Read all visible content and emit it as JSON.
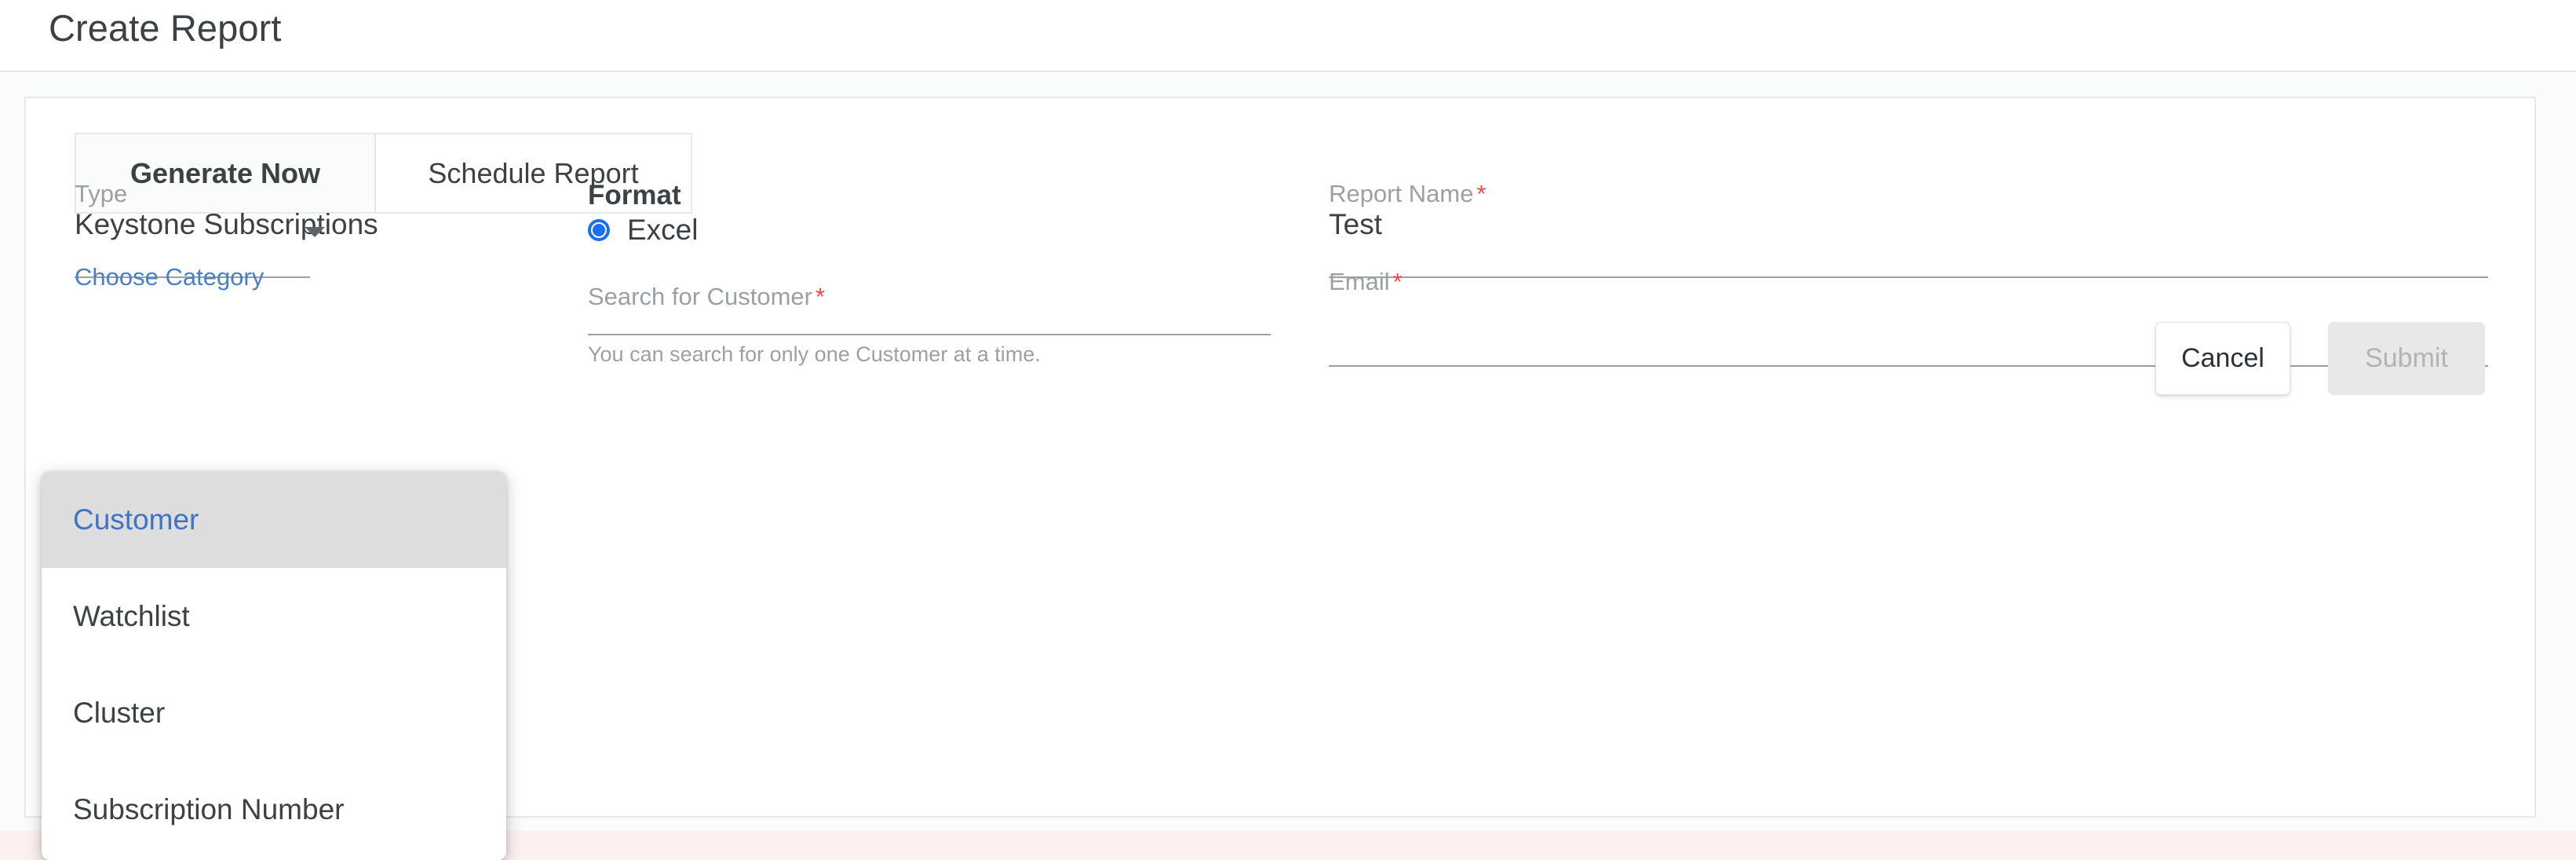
{
  "header": {
    "title": "Create Report"
  },
  "tabs": [
    {
      "label": "Generate Now",
      "active": true
    },
    {
      "label": "Schedule Report",
      "active": false
    }
  ],
  "form": {
    "type": {
      "label": "Type",
      "value": "Keystone Subscriptions",
      "caret_icon": "chevron-down-icon"
    },
    "choose_category": {
      "label": "Choose Category",
      "color": "#4a7fc1"
    },
    "format": {
      "label": "Format",
      "selected": "Excel",
      "options": [
        "Excel"
      ]
    },
    "search_customer": {
      "label": "Search for Customer",
      "required_mark": "*",
      "value": "",
      "placeholder": "",
      "hint": "You can search for only one Customer at a time."
    },
    "report_name": {
      "label": "Report Name",
      "required_mark": "*",
      "value": "Test",
      "placeholder": ""
    },
    "email": {
      "label": "Email",
      "required_mark": "*",
      "value": "",
      "placeholder": ""
    }
  },
  "category_dropdown": {
    "open": true,
    "items": [
      {
        "label": "Customer",
        "selected": true
      },
      {
        "label": "Watchlist",
        "selected": false
      },
      {
        "label": "Cluster",
        "selected": false
      },
      {
        "label": "Subscription Number",
        "selected": false
      }
    ]
  },
  "footer": {
    "cancel_label": "Cancel",
    "submit_label": "Submit",
    "submit_disabled": true
  },
  "colors": {
    "accent_blue": "#1a6ff0",
    "link_blue": "#4a7fc1",
    "required_red": "#f0474c",
    "error_strip": "#fdf0f0",
    "text_primary": "#3c4144",
    "text_muted": "#9aa0a6"
  }
}
